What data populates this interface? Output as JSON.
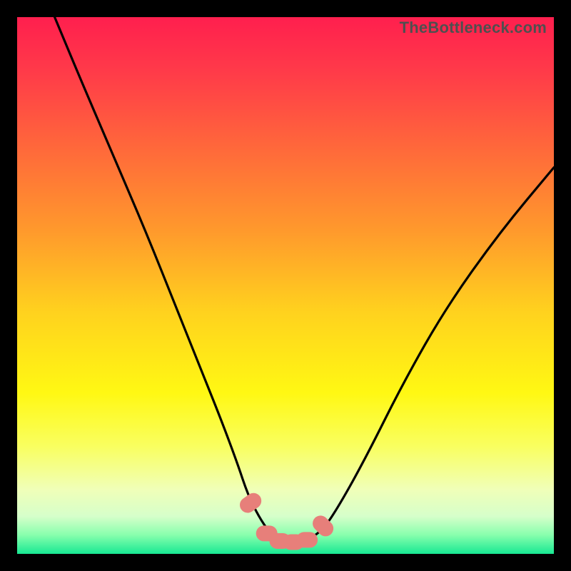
{
  "watermark": {
    "text": "TheBottleneck.com"
  },
  "colors": {
    "frame": "#000000",
    "curve": "#000000",
    "marker_fill": "#e77f7a",
    "gradient_stops": [
      {
        "offset": 0.0,
        "color": "#ff1f4e"
      },
      {
        "offset": 0.1,
        "color": "#ff3a49"
      },
      {
        "offset": 0.25,
        "color": "#ff6a3a"
      },
      {
        "offset": 0.4,
        "color": "#ff9a2c"
      },
      {
        "offset": 0.55,
        "color": "#ffd21e"
      },
      {
        "offset": 0.7,
        "color": "#fff813"
      },
      {
        "offset": 0.8,
        "color": "#f9ff60"
      },
      {
        "offset": 0.88,
        "color": "#f0ffb8"
      },
      {
        "offset": 0.93,
        "color": "#d6ffca"
      },
      {
        "offset": 0.965,
        "color": "#87ffad"
      },
      {
        "offset": 1.0,
        "color": "#18e893"
      }
    ]
  },
  "chart_data": {
    "type": "line",
    "title": "",
    "xlabel": "",
    "ylabel": "",
    "xlim": [
      0,
      100
    ],
    "ylim": [
      0,
      100
    ],
    "series": [
      {
        "name": "bottleneck-curve",
        "x": [
          7,
          12,
          18,
          24,
          30,
          34,
          38,
          41,
          43,
          45,
          47,
          49,
          51,
          54,
          57,
          60,
          65,
          72,
          80,
          90,
          100
        ],
        "y": [
          100,
          88,
          74,
          60,
          45,
          35,
          25,
          17,
          11,
          7,
          4,
          2.5,
          2,
          2.5,
          4.5,
          9,
          18,
          32,
          46,
          60,
          72
        ]
      }
    ],
    "markers": [
      {
        "name": "marker-left-edge",
        "x": 43.5,
        "y": 9.5
      },
      {
        "name": "marker-floor-left",
        "x": 46.5,
        "y": 3.8
      },
      {
        "name": "marker-floor-mid-l",
        "x": 49.0,
        "y": 2.4
      },
      {
        "name": "marker-floor-mid-r",
        "x": 51.5,
        "y": 2.2
      },
      {
        "name": "marker-floor-right",
        "x": 54.0,
        "y": 2.6
      },
      {
        "name": "marker-right-edge",
        "x": 57.0,
        "y": 5.2
      }
    ],
    "grid": false,
    "legend": false
  }
}
